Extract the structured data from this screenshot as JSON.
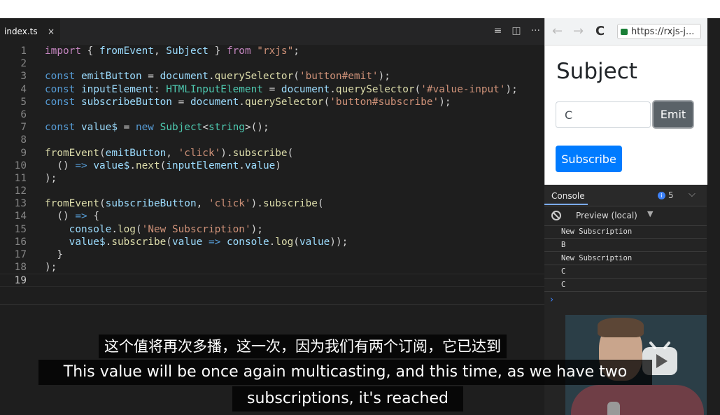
{
  "editor": {
    "tab": {
      "filename": "index.ts",
      "close": "×"
    },
    "tab_icons": [
      "≡",
      "◫",
      "···"
    ],
    "lines": [
      {
        "n": "1"
      },
      {
        "n": "2"
      },
      {
        "n": "3"
      },
      {
        "n": "4"
      },
      {
        "n": "5"
      },
      {
        "n": "6"
      },
      {
        "n": "7"
      },
      {
        "n": "8"
      },
      {
        "n": "9"
      },
      {
        "n": "10"
      },
      {
        "n": "11"
      },
      {
        "n": "12"
      },
      {
        "n": "13"
      },
      {
        "n": "14"
      },
      {
        "n": "15"
      },
      {
        "n": "16"
      },
      {
        "n": "17"
      },
      {
        "n": "18"
      },
      {
        "n": "19"
      }
    ],
    "code": {
      "l1": [
        "import",
        " { ",
        "fromEvent",
        ", ",
        "Subject",
        " } ",
        "from",
        " ",
        "\"rxjs\"",
        ";"
      ],
      "l3": [
        "const",
        " ",
        "emitButton",
        " = ",
        "document",
        ".",
        "querySelector",
        "(",
        "'button#emit'",
        ");"
      ],
      "l4": [
        "const",
        " ",
        "inputElement",
        ": ",
        "HTMLInputElement",
        " = ",
        "document",
        ".",
        "querySelector",
        "(",
        "'#value-input'",
        ");"
      ],
      "l5": [
        "const",
        " ",
        "subscribeButton",
        " = ",
        "document",
        ".",
        "querySelector",
        "(",
        "'button#subscribe'",
        ");"
      ],
      "l7": [
        "const",
        " ",
        "value$",
        " = ",
        "new",
        " ",
        "Subject",
        "<",
        "string",
        ">();"
      ],
      "l9": [
        "fromEvent",
        "(",
        "emitButton",
        ", ",
        "'click'",
        ").",
        "subscribe",
        "("
      ],
      "l10": [
        "  () ",
        "=>",
        " ",
        "value$",
        ".",
        "next",
        "(",
        "inputElement",
        ".",
        "value",
        ")"
      ],
      "l11": [
        ");"
      ],
      "l13": [
        "fromEvent",
        "(",
        "subscribeButton",
        ", ",
        "'click'",
        ").",
        "subscribe",
        "("
      ],
      "l14": [
        "  () ",
        "=>",
        " {"
      ],
      "l15": [
        "    ",
        "console",
        ".",
        "log",
        "(",
        "'New Subscription'",
        ");"
      ],
      "l16": [
        "    ",
        "value$",
        ".",
        "subscribe",
        "(",
        "value",
        " ",
        "=>",
        " ",
        "console",
        ".",
        "log",
        "(",
        "value",
        "));"
      ],
      "l17": [
        "  }"
      ],
      "l18": [
        ");"
      ]
    }
  },
  "browser": {
    "nav": {
      "back": "←",
      "forward": "→",
      "reload": "C"
    },
    "url": "https://rxjs-j...",
    "heading": "Subject",
    "input_value": "C",
    "emit_label": "Emit",
    "subscribe_label": "Subscribe"
  },
  "console": {
    "tab_label": "Console",
    "issue_count": "5",
    "issue_dot": "i",
    "chevron": "⌵",
    "context": "Preview (local)",
    "context_arrow": "▼",
    "logs": [
      "New Subscription",
      "B",
      "New Subscription",
      "C",
      "C"
    ],
    "prompt": "›"
  },
  "subtitles": {
    "chinese": "这个值将再次多播，这一次，因为我们有两个订阅，它已达到",
    "english_line1": "This value will be once again multicasting, and this time, as we have two",
    "english_line2": "subscriptions, it's reached"
  },
  "colors": {
    "editor_bg": "#1e1e1e",
    "keyword": "#569cd6",
    "string": "#ce9178",
    "emit_button": "#5a6268",
    "subscribe_button": "#007bff"
  }
}
